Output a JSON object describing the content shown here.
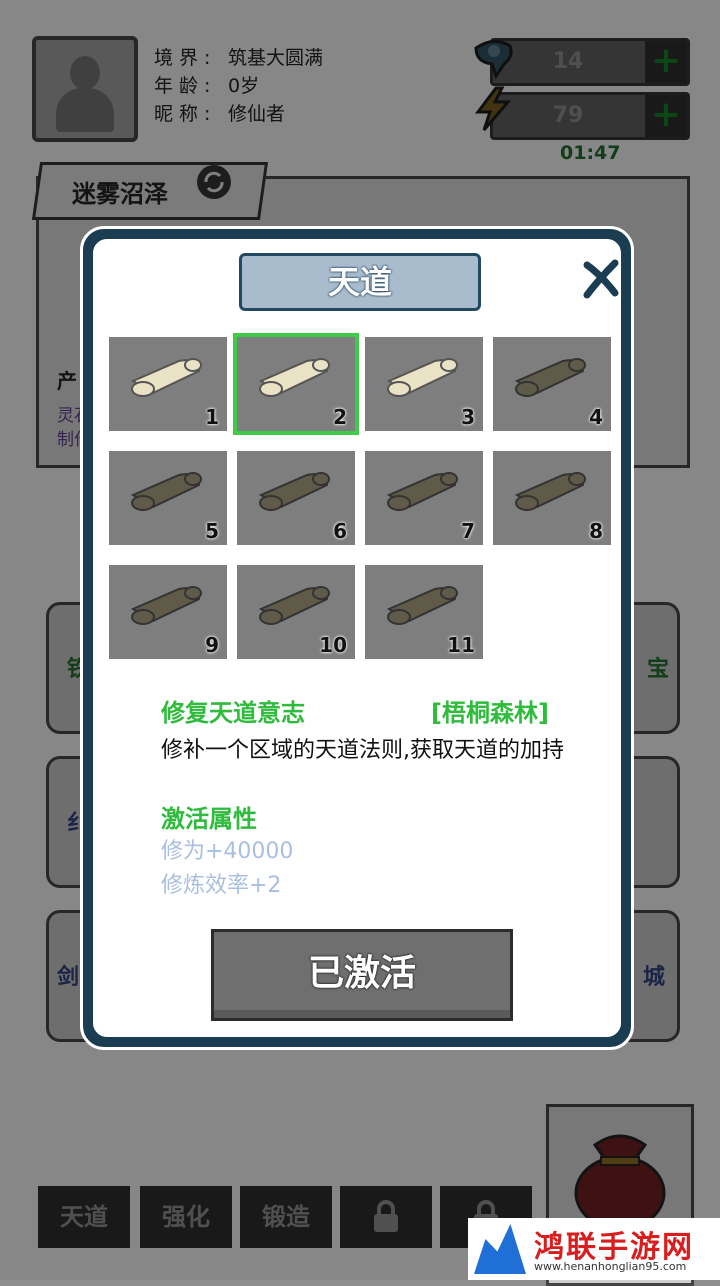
{
  "player": {
    "realm_label": "境界:",
    "realm_value": "筑基大圆满",
    "age_label": "年龄:",
    "age_value": "0岁",
    "nick_label": "昵称:",
    "nick_value": "修仙者"
  },
  "resources": {
    "spirit_value": "14",
    "energy_value": "79",
    "plus": "+",
    "timer": "01:47"
  },
  "location": {
    "name": "迷雾沼泽"
  },
  "background_hints": {
    "left_btns": [
      "铁",
      "纟",
      "剑"
    ],
    "right_btns": [
      "宝",
      "",
      "城"
    ],
    "produce": "产",
    "purple1": "灵石",
    "purple2": "制作"
  },
  "bottom_tabs": {
    "tab1": "天道",
    "tab2": "强化",
    "tab3": "锻造"
  },
  "watermark": {
    "title": "鸿联手游网",
    "url": "www.henanhonglian95.com"
  },
  "modal": {
    "title": "天道",
    "cells": [
      {
        "num": "1",
        "active": true
      },
      {
        "num": "2",
        "active": true,
        "selected": true
      },
      {
        "num": "3",
        "active": true
      },
      {
        "num": "4",
        "active": false
      },
      {
        "num": "5",
        "active": false
      },
      {
        "num": "6",
        "active": false
      },
      {
        "num": "7",
        "active": false
      },
      {
        "num": "8",
        "active": false
      },
      {
        "num": "9",
        "active": false
      },
      {
        "num": "10",
        "active": false
      },
      {
        "num": "11",
        "active": false
      }
    ],
    "skill_name": "修复天道意志",
    "skill_region": "[梧桐森林]",
    "skill_desc": "修补一个区域的天道法则,获取天道的加持",
    "attr_title": "激活属性",
    "attr1": "修为+40000",
    "attr2": "修炼效率+2",
    "button": "已激活"
  },
  "colors": {
    "accent_green": "#2fbb3c",
    "attr_blue": "#a9bfe0",
    "modal_border": "#1b3d52"
  }
}
